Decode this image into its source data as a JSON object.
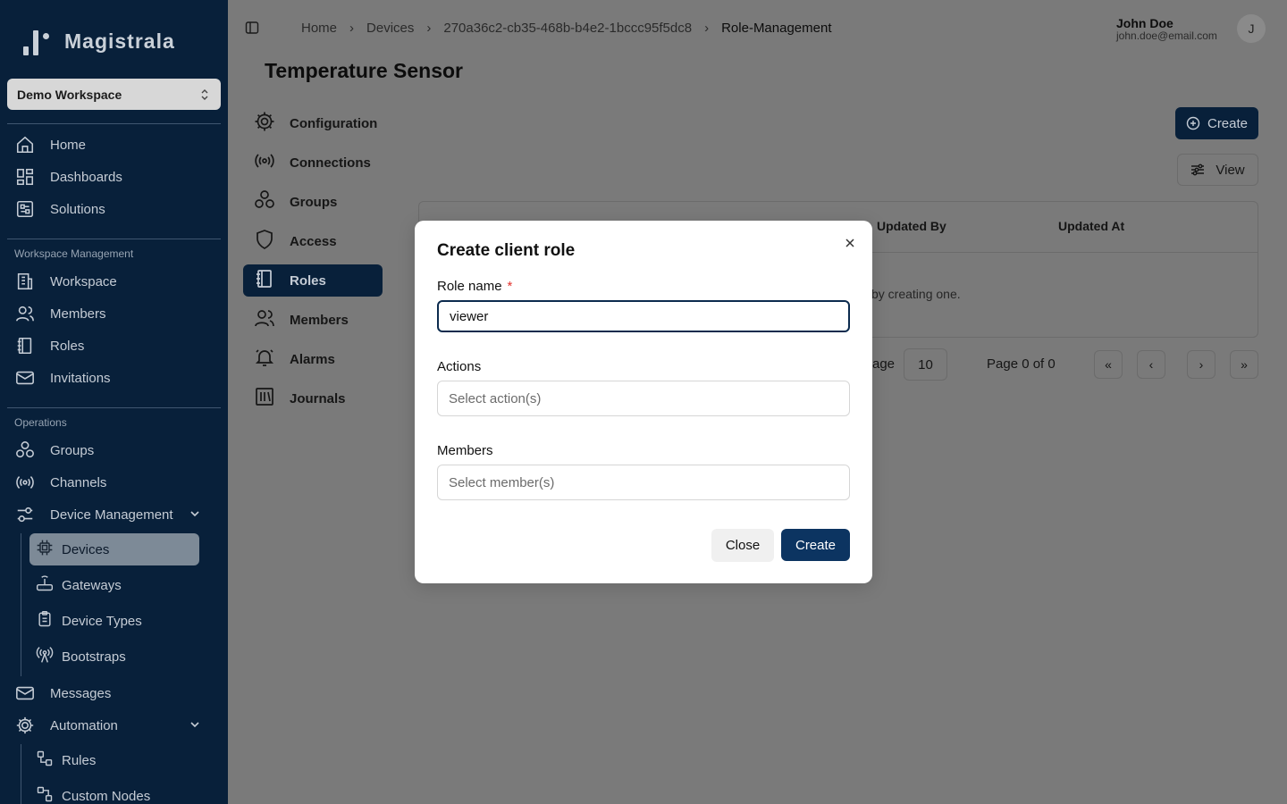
{
  "app": {
    "name": "Magistrala"
  },
  "workspace": {
    "selected": "Demo Workspace"
  },
  "sidebar": {
    "main": [
      {
        "label": "Home",
        "icon": "home-icon"
      },
      {
        "label": "Dashboards",
        "icon": "dashboard-icon"
      },
      {
        "label": "Solutions",
        "icon": "solutions-icon"
      }
    ],
    "workspace_management": {
      "heading": "Workspace Management",
      "items": [
        {
          "label": "Workspace",
          "icon": "building-icon"
        },
        {
          "label": "Members",
          "icon": "users-icon"
        },
        {
          "label": "Roles",
          "icon": "notebook-icon"
        },
        {
          "label": "Invitations",
          "icon": "mail-icon"
        }
      ]
    },
    "operations": {
      "heading": "Operations",
      "items": [
        {
          "label": "Groups",
          "icon": "groups-icon"
        },
        {
          "label": "Channels",
          "icon": "broadcast-icon"
        },
        {
          "label": "Device Management",
          "icon": "sliders-icon"
        }
      ],
      "device_management_sub": [
        {
          "label": "Devices",
          "icon": "chip-icon"
        },
        {
          "label": "Gateways",
          "icon": "router-icon"
        },
        {
          "label": "Device Types",
          "icon": "clipboard-icon"
        },
        {
          "label": "Bootstraps",
          "icon": "antenna-icon"
        }
      ],
      "after": [
        {
          "label": "Messages",
          "icon": "mail-open-icon"
        },
        {
          "label": "Automation",
          "icon": "gear-icon"
        }
      ],
      "automation_sub": [
        {
          "label": "Rules",
          "icon": "workflow-icon"
        },
        {
          "label": "Custom Nodes",
          "icon": "nodes-icon"
        }
      ]
    }
  },
  "breadcrumb": [
    "Home",
    "Devices",
    "270a36c2-cb35-468b-b4e2-1bccc95f5dc8",
    "Role-Management"
  ],
  "user": {
    "name": "John Doe",
    "email": "john.doe@email.com",
    "initial": "J"
  },
  "page": {
    "title": "Temperature Sensor",
    "tabs": [
      "Configuration",
      "Connections",
      "Groups",
      "Access",
      "Roles",
      "Members",
      "Alarms",
      "Journals"
    ],
    "active_tab": "Roles",
    "create_label": "Create",
    "view_label": "View",
    "table": {
      "headers": [
        "Updated By",
        "Updated At"
      ],
      "empty_text": "by creating one."
    },
    "pagination": {
      "rows_label": "age",
      "rows_per_page": "10",
      "page_info": "Page 0 of 0"
    }
  },
  "modal": {
    "title": "Create client role",
    "role_name_label": "Role name",
    "required_marker": "*",
    "role_name_value": "viewer",
    "actions_label": "Actions",
    "actions_placeholder": "Select action(s)",
    "members_label": "Members",
    "members_placeholder": "Select member(s)",
    "close_label": "Close",
    "create_label": "Create"
  }
}
